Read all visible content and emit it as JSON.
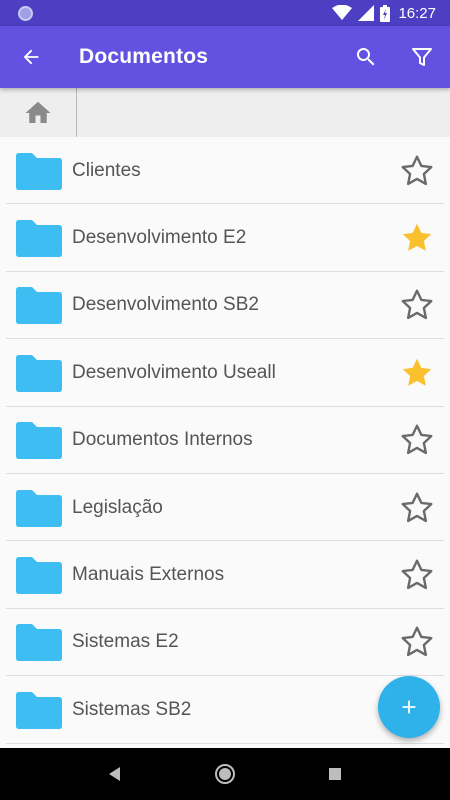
{
  "status_bar": {
    "time": "16:27"
  },
  "app_bar": {
    "title": "Documentos"
  },
  "colors": {
    "status_bar": "#4c3fc1",
    "app_bar": "#6352e2",
    "folder": "#3dbdf2",
    "star_filled": "#fbc02d",
    "star_outline": "#6a6a6a",
    "fab": "#2fb2ea"
  },
  "folders": [
    {
      "name": "Clientes",
      "starred": false
    },
    {
      "name": "Desenvolvimento E2",
      "starred": true
    },
    {
      "name": "Desenvolvimento SB2",
      "starred": false
    },
    {
      "name": "Desenvolvimento Useall",
      "starred": true
    },
    {
      "name": "Documentos Internos",
      "starred": false
    },
    {
      "name": "Legislação",
      "starred": false
    },
    {
      "name": "Manuais Externos",
      "starred": false
    },
    {
      "name": "Sistemas E2",
      "starred": false
    },
    {
      "name": "Sistemas SB2",
      "starred": false
    }
  ]
}
